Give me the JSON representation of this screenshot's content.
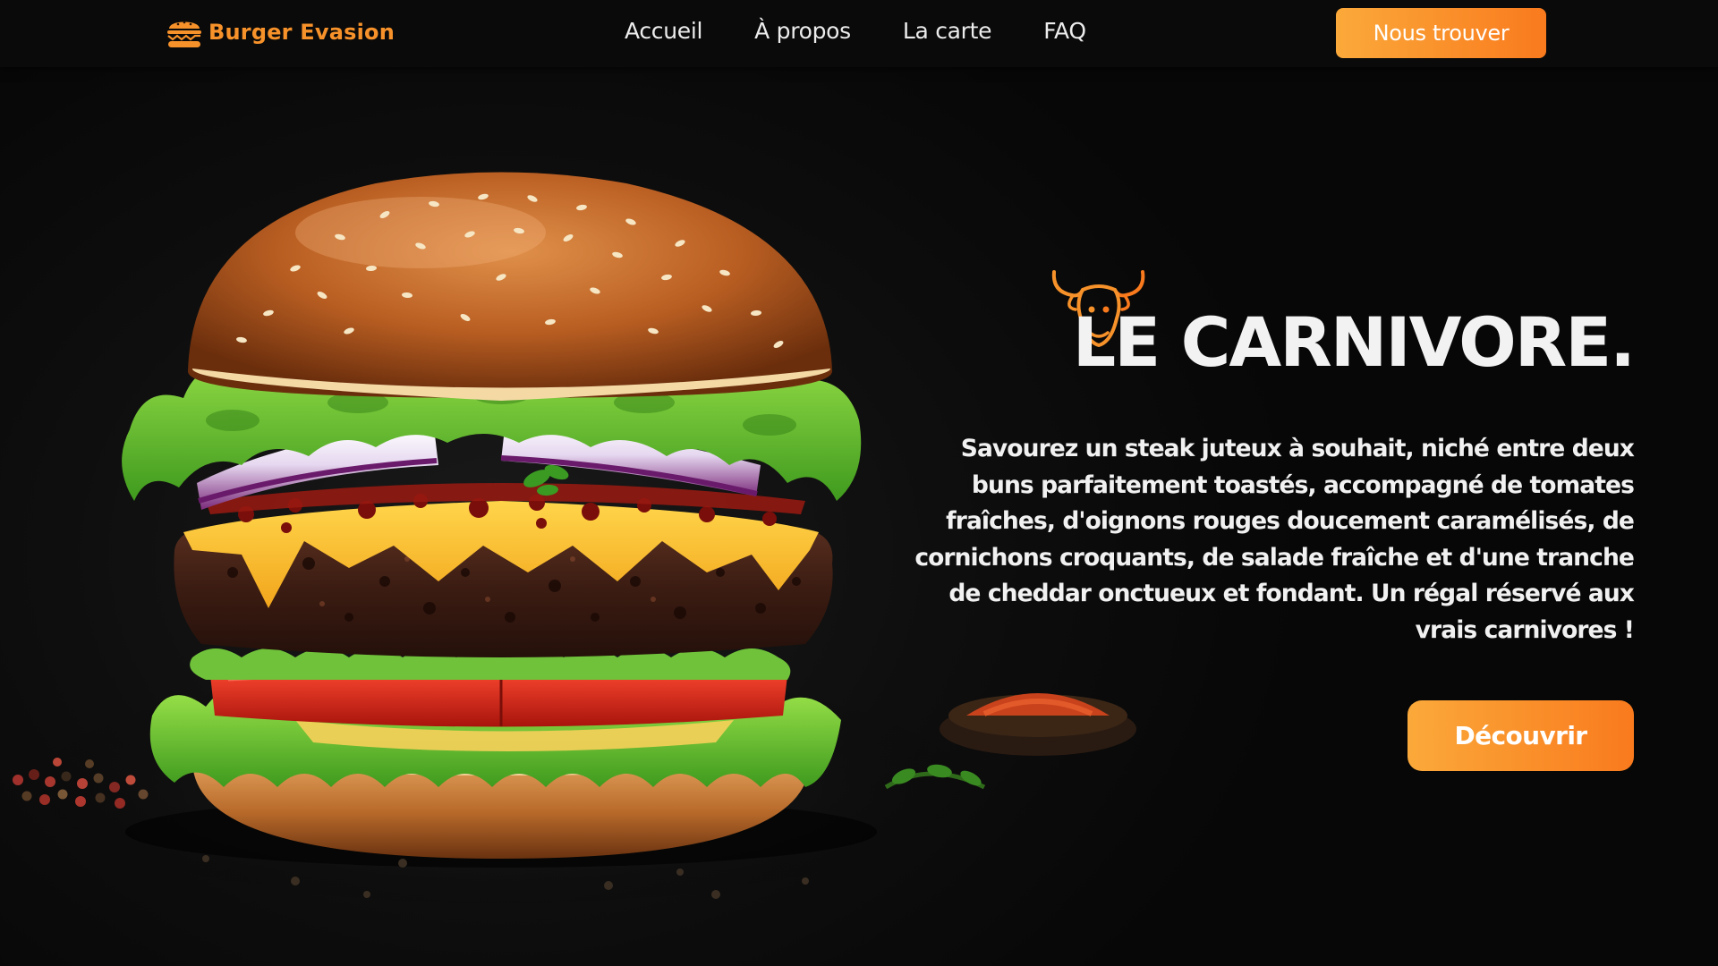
{
  "brand": {
    "name": "Burger Evasion",
    "icon": "burger-icon",
    "color": "#f7922a"
  },
  "nav": {
    "links": [
      "Accueil",
      "À propos",
      "La carte",
      "FAQ"
    ],
    "cta_label": "Nous trouver"
  },
  "hero": {
    "image": "burger-photo",
    "badge_icon": "bull-head-icon",
    "title": "LE CARNIVORE.",
    "description": "Savourez un steak juteux à souhait, niché entre deux buns parfaitement toastés, accompagné de tomates fraîches, d'oignons rouges doucement caramélisés, de cornichons croquants, de salade fraîche et d'une tranche de cheddar onctueux et fondant. Un régal réservé aux vrais carnivores !",
    "cta_label": "Découvrir"
  },
  "colors": {
    "accent_start": "#fba93a",
    "accent_end": "#f97a1d",
    "background": "#0b0b0b",
    "text": "#f1f1f1"
  }
}
